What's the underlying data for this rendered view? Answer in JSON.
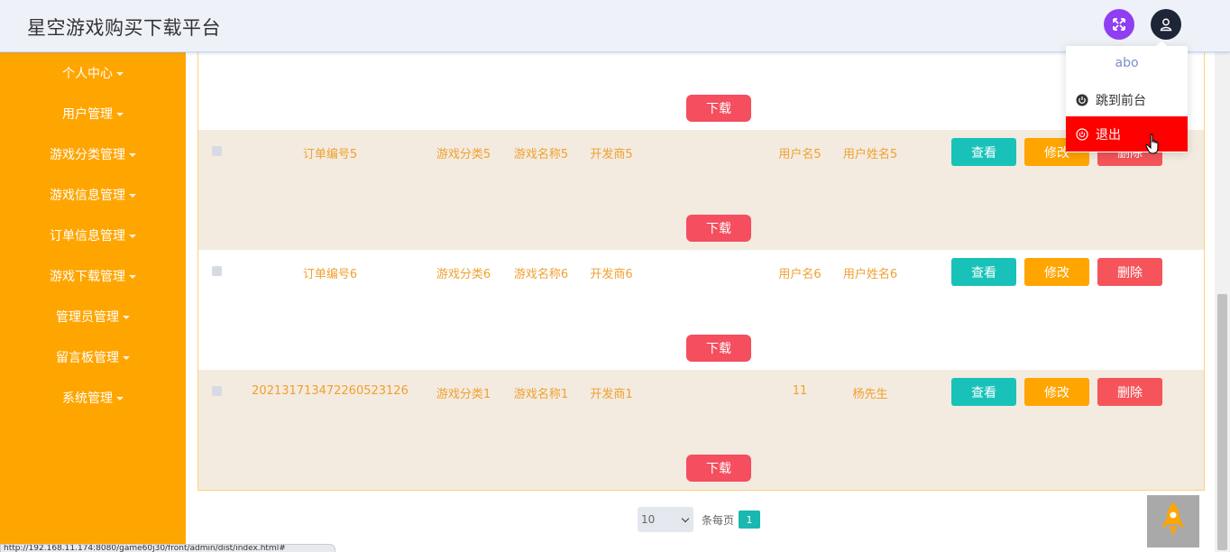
{
  "header": {
    "title": "星空游戏购买下载平台"
  },
  "sidebar": {
    "items": [
      {
        "label": "个人中心"
      },
      {
        "label": "用户管理"
      },
      {
        "label": "游戏分类管理"
      },
      {
        "label": "游戏信息管理"
      },
      {
        "label": "订单信息管理"
      },
      {
        "label": "游戏下载管理"
      },
      {
        "label": "管理员管理"
      },
      {
        "label": "留言板管理"
      },
      {
        "label": "系统管理"
      }
    ]
  },
  "table": {
    "download_label": "下载",
    "view_label": "查看",
    "edit_label": "修改",
    "delete_label": "删除",
    "rows": [
      {
        "order_no": "订单编号5",
        "category": "游戏分类5",
        "game_name": "游戏名称5",
        "developer": "开发商5",
        "username": "用户名5",
        "real_name": "用户姓名5"
      },
      {
        "order_no": "订单编号6",
        "category": "游戏分类6",
        "game_name": "游戏名称6",
        "developer": "开发商6",
        "username": "用户名6",
        "real_name": "用户姓名6"
      },
      {
        "order_no": "20213171347226052312​6",
        "category": "游戏分类1",
        "game_name": "游戏名称1",
        "developer": "开发商1",
        "username": "11",
        "real_name": "杨先生"
      }
    ]
  },
  "pagination": {
    "page_size": "10",
    "per_page_label": "条每页",
    "current_page": "1"
  },
  "dropdown": {
    "username": "abo",
    "front_label": "跳到前台",
    "logout_label": "退出"
  },
  "status_bar": {
    "url": "http://192.168.11.174:8080/game60j30/front/admin/dist/index.html#"
  },
  "colors": {
    "sidebar": "#ffa500",
    "accent_teal": "#19c2b8",
    "danger": "#f5545a",
    "logout": "#ff0000"
  }
}
